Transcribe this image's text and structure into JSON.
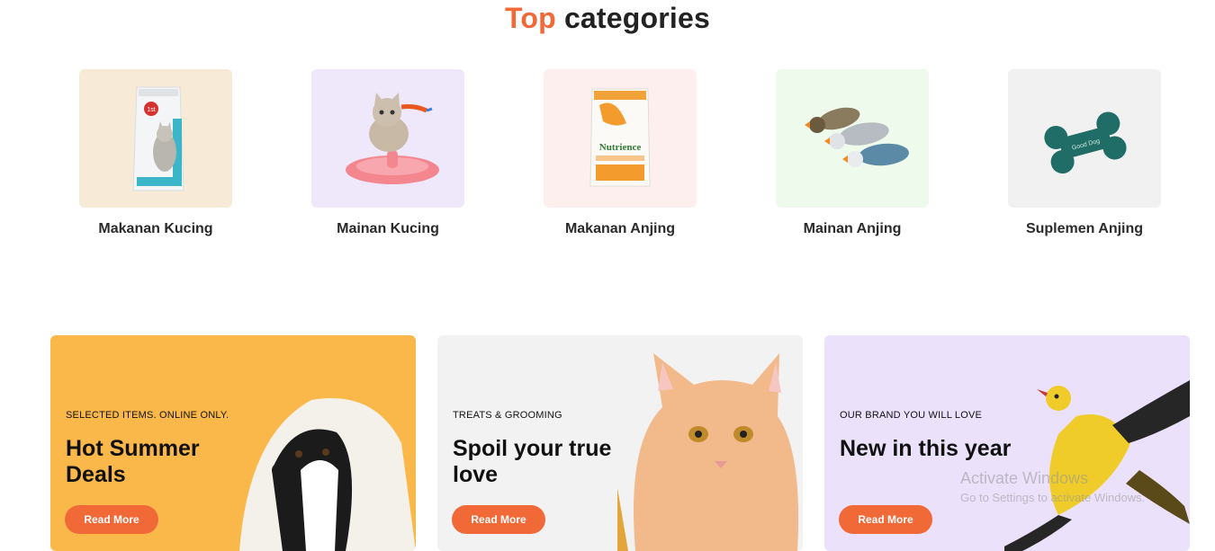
{
  "section": {
    "title_accent": "Top",
    "title_rest": "categories"
  },
  "categories": [
    {
      "label": "Makanan Kucing",
      "bg": "#f7ead6",
      "icon": "cat-food-bag-icon"
    },
    {
      "label": "Mainan Kucing",
      "bg": "#efe8fb",
      "icon": "cat-toy-icon"
    },
    {
      "label": "Makanan Anjing",
      "bg": "#fdefee",
      "icon": "dog-food-bag-icon"
    },
    {
      "label": "Mainan Anjing",
      "bg": "#eefaec",
      "icon": "duck-toys-icon"
    },
    {
      "label": "Suplemen Anjing",
      "bg": "#f1f1f1",
      "icon": "bone-toy-icon"
    }
  ],
  "banners": [
    {
      "kicker": "SELECTED ITEMS. ONLINE ONLY.",
      "headline": "Hot Summer Deals",
      "button": "Read More",
      "bg": "#fbb84a",
      "image": "dog-in-towel"
    },
    {
      "kicker": "TREATS & GROOMING",
      "headline": "Spoil your true love",
      "button": "Read More",
      "bg": "#f2f2f2",
      "image": "orange-cat"
    },
    {
      "kicker": "OUR BRAND YOU WILL LOVE",
      "headline": "New in this year",
      "button": "Read More",
      "bg": "#ece1fb",
      "image": "yellow-bird"
    }
  ],
  "watermark": {
    "line1": "Activate Windows",
    "line2": "Go to Settings to activate Windows."
  },
  "colors": {
    "accent": "#f26938"
  }
}
